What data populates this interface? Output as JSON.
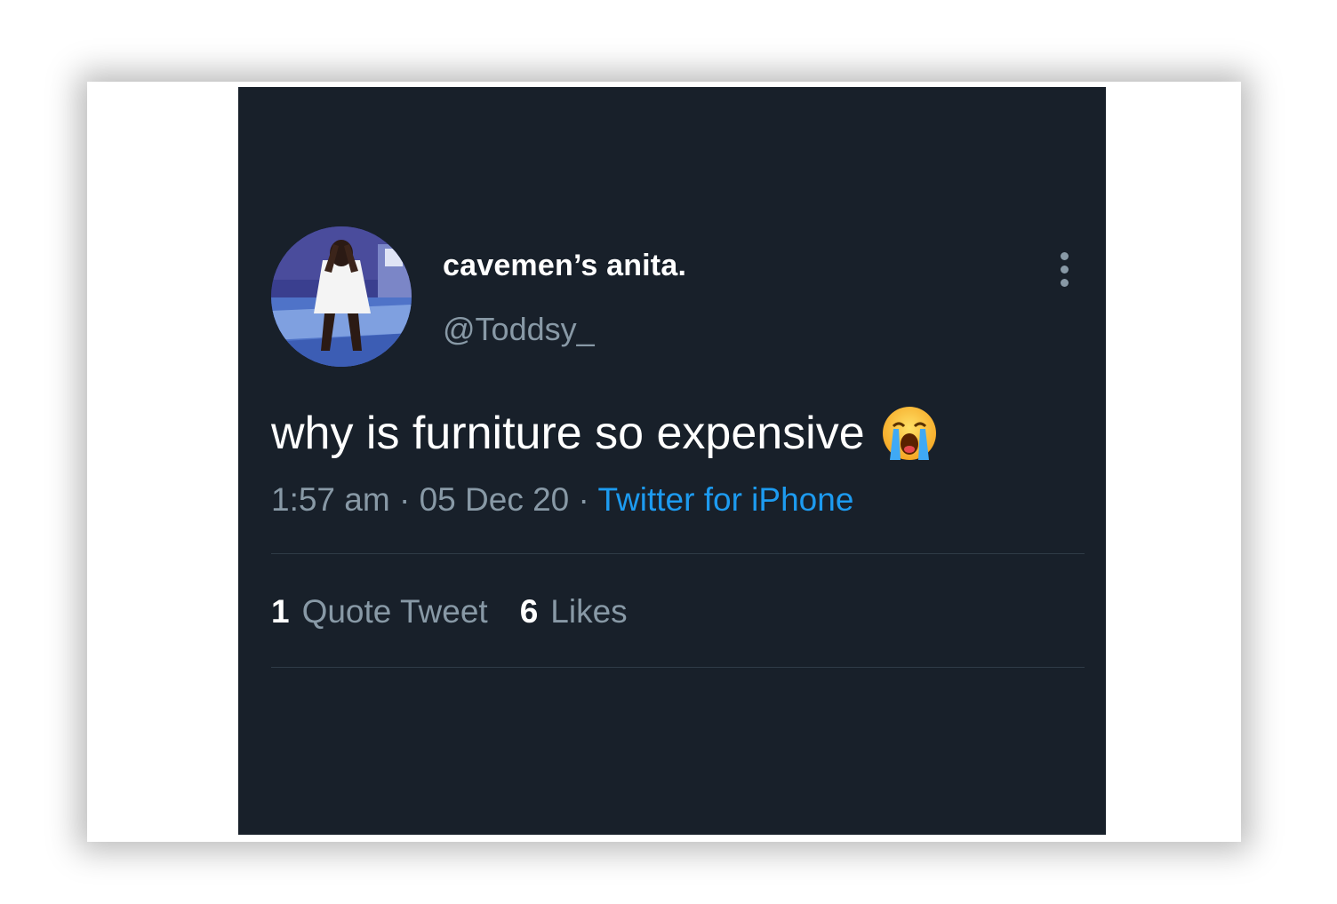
{
  "tweet": {
    "display_name": "cavemen’s anita.",
    "handle": "@Toddsy_",
    "text": "why is furniture so expensive",
    "emoji": "loudly-crying-face",
    "time": "1:57 am",
    "date": "05 Dec 20",
    "separator": "·",
    "source": "Twitter for iPhone",
    "stats": {
      "quote_count": "1",
      "quote_label": "Quote Tweet",
      "like_count": "6",
      "like_label": "Likes"
    }
  },
  "colors": {
    "card_background": "#18202a",
    "secondary_text": "#8899a6",
    "link": "#1d9bf0",
    "divider": "#2f3b47"
  },
  "icons": {
    "more": "more-vertical-icon",
    "avatar": "profile-avatar"
  }
}
